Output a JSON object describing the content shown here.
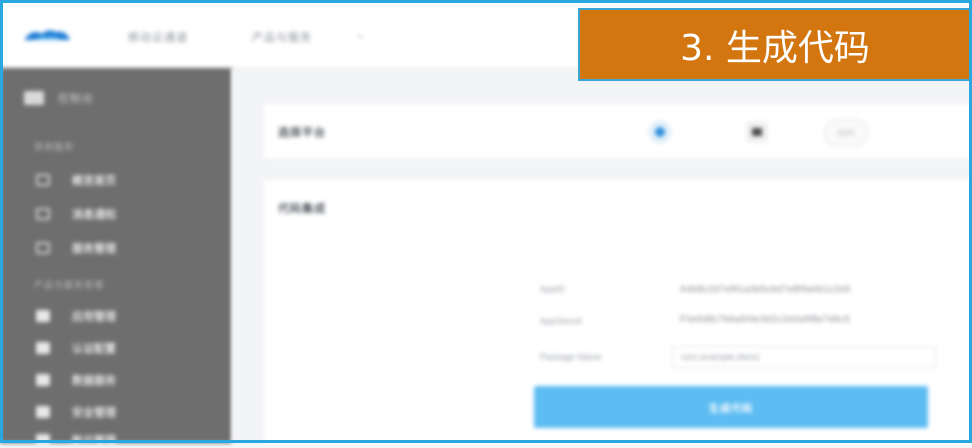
{
  "step_badge": {
    "label": "3. 生成代码"
  },
  "topbar": {
    "logo_icon": "cloud-logo-icon",
    "links": [
      "移动云通道",
      "产品与服务"
    ],
    "dropdown_icon": "chevron-down-icon"
  },
  "sidebar": {
    "header_label": "控制台",
    "groups": [
      {
        "title": "常用服务",
        "items": [
          {
            "label": "概览首页",
            "icon": "grid-icon"
          },
          {
            "label": "消息通知",
            "icon": "message-icon"
          },
          {
            "label": "服务管理",
            "icon": "list-icon"
          }
        ]
      },
      {
        "title": "产品与服务管理",
        "items": [
          {
            "label": "应用管理",
            "icon": "app-icon"
          },
          {
            "label": "认证配置",
            "icon": "shield-icon"
          },
          {
            "label": "数据服务",
            "icon": "database-icon"
          },
          {
            "label": "安全管理",
            "icon": "settings-icon"
          },
          {
            "label": "账户管理",
            "icon": "user-icon"
          }
        ]
      }
    ]
  },
  "content": {
    "row1": {
      "label": "选择平台",
      "pill_label": "SDK"
    },
    "row2": {
      "label": "代码集成"
    },
    "form": {
      "fields": [
        {
          "label": "AppID",
          "value": "A4b8c2d7e9f1a3b5c6d7e8f9a0b1c2d3"
        },
        {
          "label": "AppSecret",
          "value": "F0e9d8c7b6a5f4e3d2c1b0a9f8e7d6c5"
        }
      ],
      "input": {
        "label": "Package Name",
        "placeholder": "com.example.demo"
      },
      "generate_button": "生成代码"
    }
  },
  "colors": {
    "badge": "#d47610",
    "frame": "#29a8e0",
    "sidebar": "#6e6e6e",
    "primary": "#5dbcf2",
    "accent_dot": "#2d8ed8"
  }
}
